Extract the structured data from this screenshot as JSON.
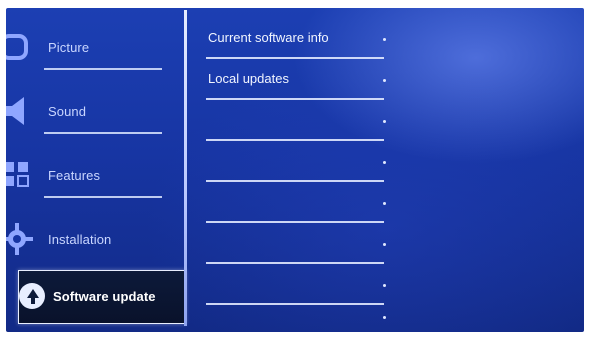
{
  "sidebar": {
    "items": [
      {
        "label": "Picture",
        "icon": "picture-icon"
      },
      {
        "label": "Sound",
        "icon": "speaker-icon"
      },
      {
        "label": "Features",
        "icon": "features-icon"
      },
      {
        "label": "Installation",
        "icon": "gear-icon"
      },
      {
        "label": "Software update",
        "icon": "update-icon",
        "selected": true
      }
    ]
  },
  "submenu": {
    "items": [
      {
        "label": "Current software info"
      },
      {
        "label": "Local updates"
      },
      {
        "label": ""
      },
      {
        "label": ""
      },
      {
        "label": ""
      },
      {
        "label": ""
      },
      {
        "label": ""
      },
      {
        "label": ""
      }
    ]
  },
  "colors": {
    "background": "#1735a3",
    "text": "#f1f5ff",
    "selected_bg": "#0d1a3a"
  }
}
